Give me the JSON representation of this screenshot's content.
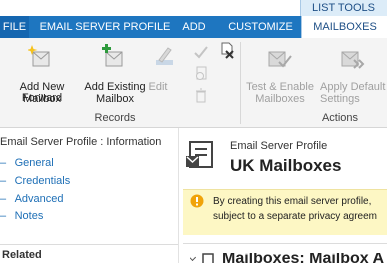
{
  "ribbon": {
    "contextual_group": "LIST TOOLS",
    "tabs": {
      "file": "FILE",
      "email_server_profile": "EMAIL SERVER PROFILE",
      "add": "ADD",
      "customize": "CUSTOMIZE",
      "mailboxes": "MAILBOXES"
    },
    "buttons": {
      "add_new_forward_line1": "Add New Forward",
      "add_new_forward_line2": "Mailbox",
      "add_existing_line1": "Add Existing",
      "add_existing_line2": "Mailbox",
      "edit": "Edit",
      "test_enable_line1": "Test & Enable",
      "test_enable_line2": "Mailboxes",
      "apply_default_line1": "Apply Default",
      "apply_default_line2": "Settings"
    },
    "groups": {
      "records": "Records",
      "actions": "Actions"
    }
  },
  "nav": {
    "header": "Email Server Profile : Information",
    "links": [
      "General",
      "Credentials",
      "Advanced",
      "Notes"
    ],
    "related": "Related"
  },
  "content": {
    "entity_type": "Email Server Profile",
    "record_name": "UK Mailboxes",
    "alert_line1": "By creating this email server profile,",
    "alert_line2": "subject to a separate privacy agreem",
    "partial_heading": "Mailboxes: Mailbox A"
  },
  "colors": {
    "tab_bar": "#1e76c0",
    "active_tab_text": "#1e4f86",
    "link": "#1e6fb6",
    "alert_bg": "#fdf7c4",
    "alert_icon": "#f0a30a"
  }
}
